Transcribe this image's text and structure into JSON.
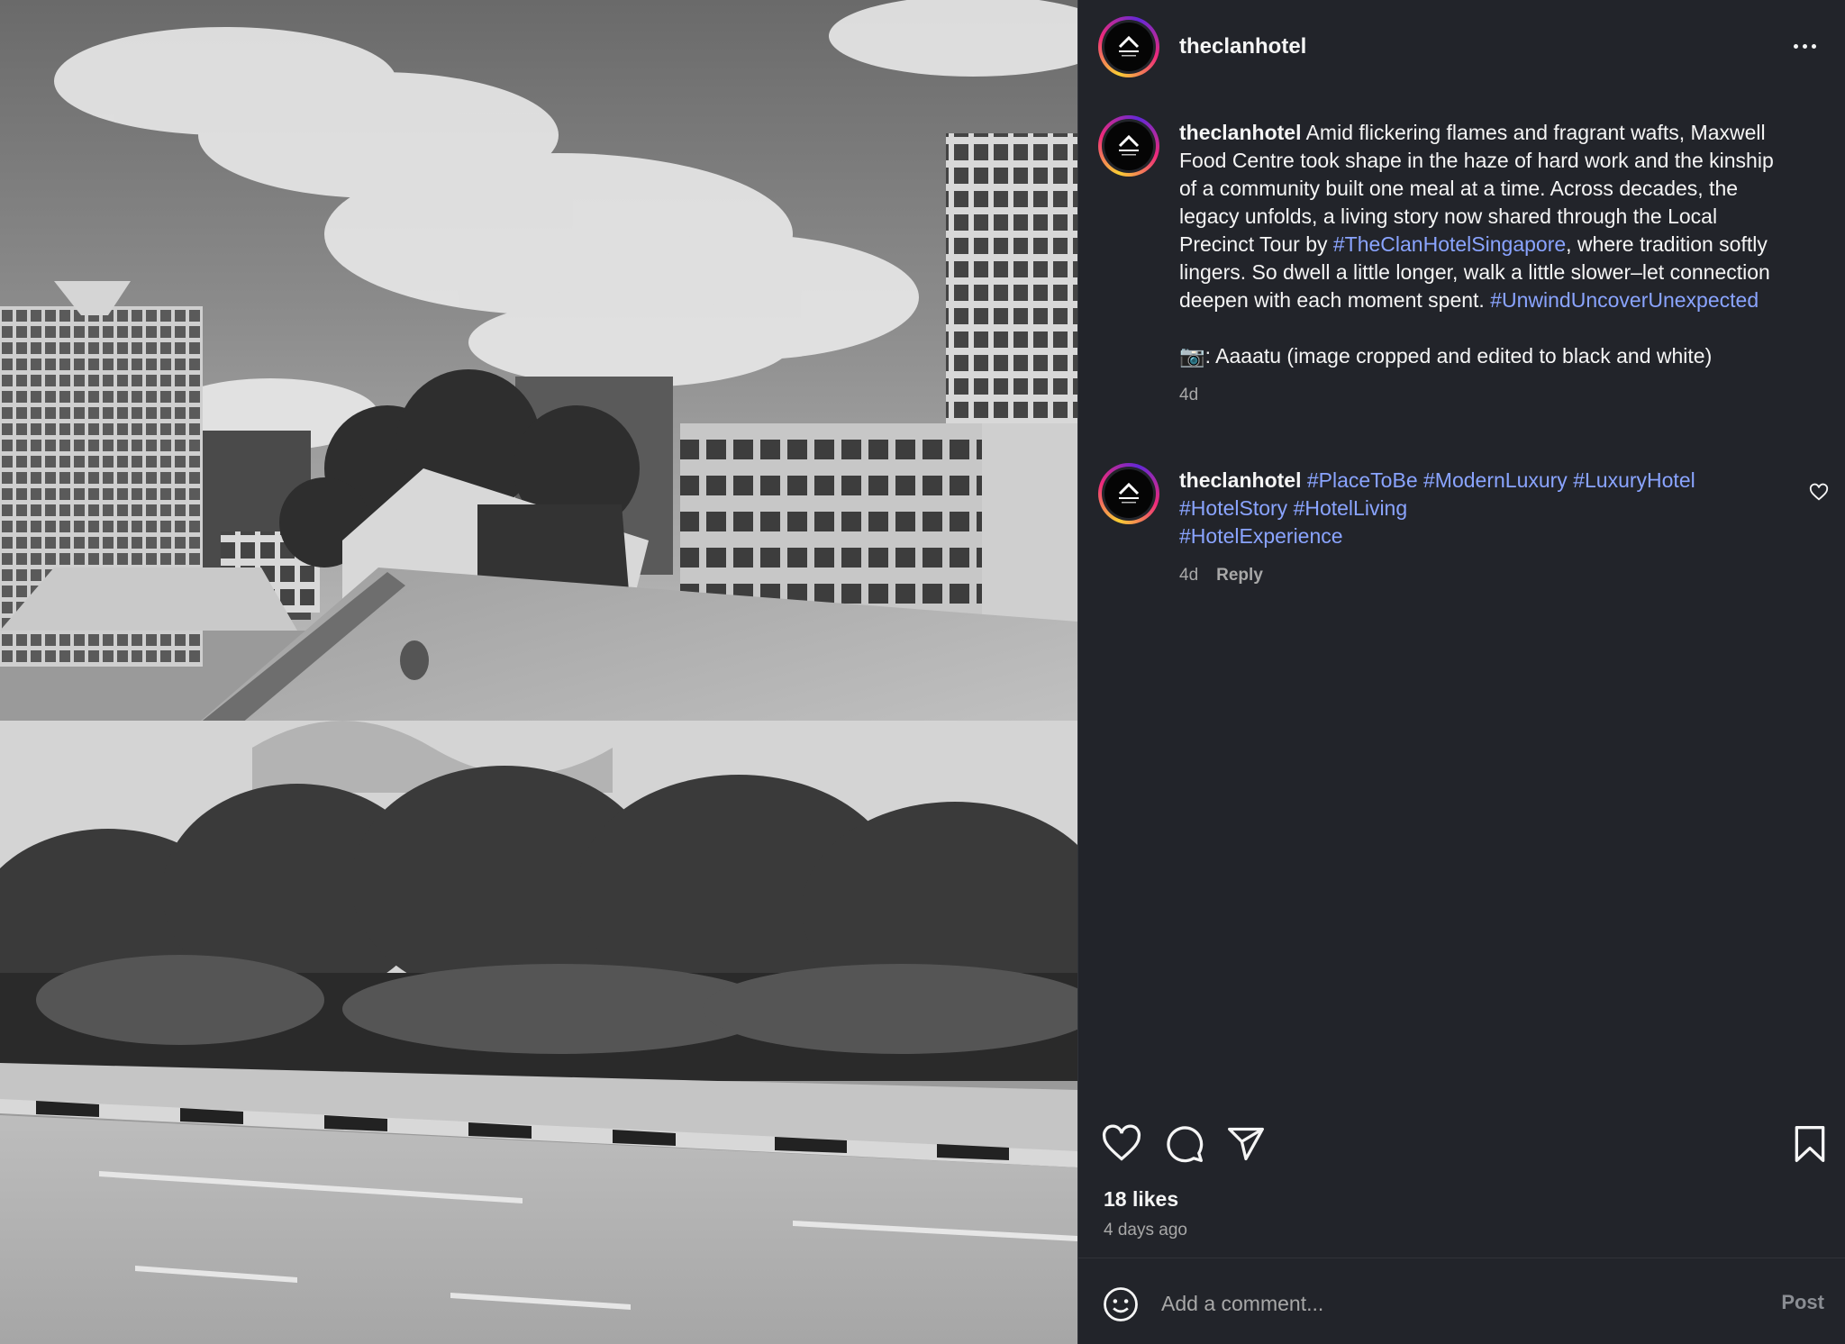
{
  "post": {
    "username": "theclanhotel",
    "caption": {
      "username": "theclanhotel",
      "text_before_tag": " Amid flickering flames and fragrant wafts, Maxwell Food Centre took shape in the haze of hard work and the kinship of a community built one meal at a time. Across decades, the legacy unfolds, a living story now shared through the Local Precinct Tour by ",
      "tag_1": "#TheClanHotelSingapore",
      "text_after_tag": ", where tradition softly lingers. So dwell a little longer, walk a little slower–let connection deepen with each moment spent. ",
      "tag_2": "#UnwindUncoverUnexpected",
      "credit": "📷: Aaaatu (image cropped and edited to black and white)",
      "time": "4d"
    },
    "comments": [
      {
        "username": "theclanhotel",
        "tags": [
          "#PlaceToBe",
          "#ModernLuxury",
          "#LuxuryHotel",
          "#HotelStory",
          "#HotelLiving",
          "#HotelExperience"
        ],
        "time": "4d",
        "reply_label": "Reply"
      }
    ],
    "likes": "18 likes",
    "posted_ago": "4 days ago"
  },
  "comment_box": {
    "placeholder": "Add a comment...",
    "post_label": "Post"
  },
  "icons": {
    "avatar": "the-clan-logo",
    "more": "more-options-icon",
    "like": "heart-icon",
    "comment": "comment-bubble-icon",
    "share": "paper-plane-icon",
    "save": "bookmark-icon",
    "emoji": "emoji-icon"
  },
  "colors": {
    "panel_bg": "#22242a",
    "hashtag": "#8aa4ff",
    "muted": "#a8a8a8"
  }
}
